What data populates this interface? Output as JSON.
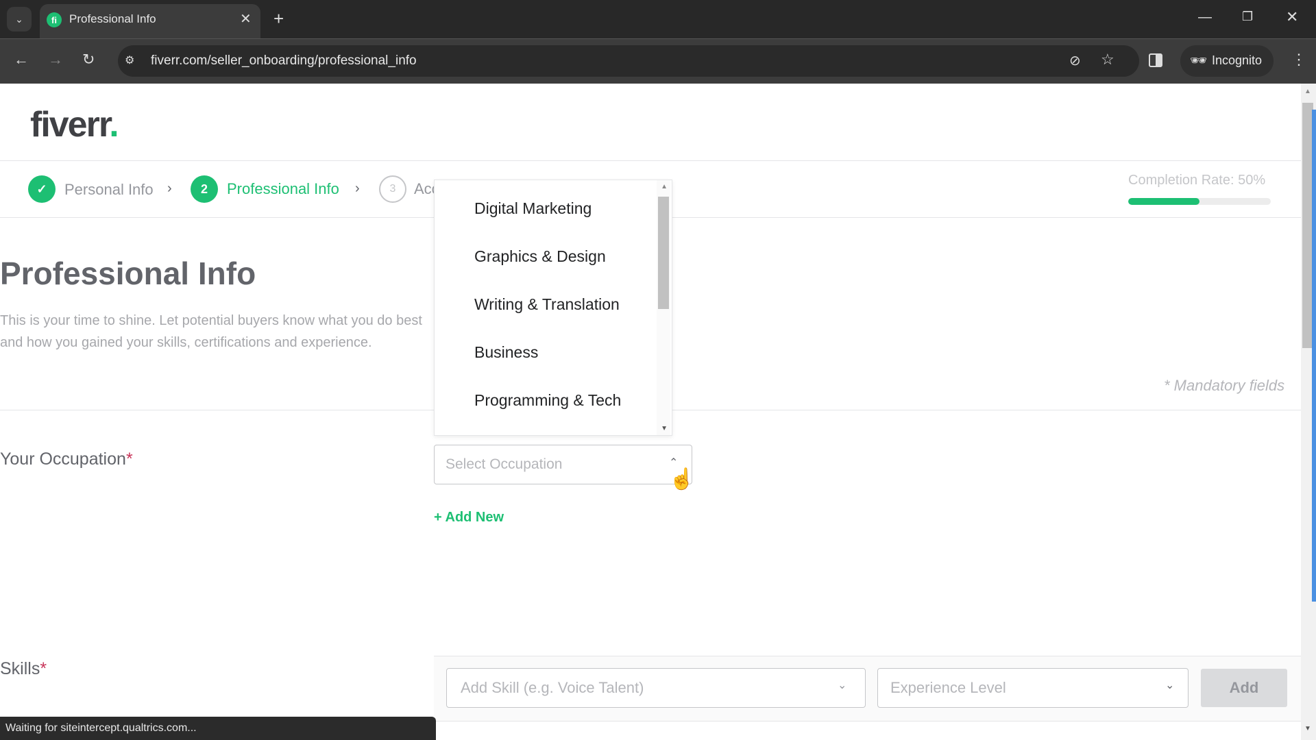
{
  "browser": {
    "tab_title": "Professional Info",
    "tab_favicon": "fi",
    "url": "fiverr.com/seller_onboarding/professional_info",
    "profile_label": "Incognito",
    "status_text": "Waiting for siteintercept.qualtrics.com...",
    "icons": {
      "tab_search": "⌄",
      "tab_close": "✕",
      "new_tab": "+",
      "minimize": "—",
      "maximize": "❐",
      "window_close": "✕",
      "back": "←",
      "forward": "→",
      "reload": "↻",
      "site_info": "⚙",
      "eye_off": "⊘",
      "star": "☆",
      "incognito": "🕶",
      "menu": "⋮"
    }
  },
  "brand": {
    "logo_text": "fiverr",
    "logo_dot": ".",
    "accent_color": "#1dbf73"
  },
  "steps": [
    {
      "number": "✓",
      "label": "Personal Info",
      "state": "complete"
    },
    {
      "number": "2",
      "label": "Professional Info",
      "state": "active"
    },
    {
      "number": "3",
      "label": "Account Security",
      "state": "pending",
      "visible_label": "Ac"
    }
  ],
  "step_separator": "›",
  "completion": {
    "label": "Completion Rate: 50%",
    "percent": 50
  },
  "main": {
    "title": "Professional Info",
    "description": "This is your time to shine. Let potential buyers know what you do best and how you gained your skills, certifications and experience.",
    "mandatory_note": "* Mandatory fields"
  },
  "occupation": {
    "label": "Your Occupation",
    "required_mark": "*",
    "placeholder": "Select Occupation",
    "chevron": "⌃",
    "add_new": "+ Add New",
    "options": [
      "Digital Marketing",
      "Graphics & Design",
      "Writing & Translation",
      "Business",
      "Programming & Tech"
    ]
  },
  "skills": {
    "label": "Skills",
    "required_mark": "*",
    "skill_placeholder": "Add Skill (e.g. Voice Talent)",
    "experience_placeholder": "Experience Level",
    "chevron": "⌄",
    "add_button": "Add"
  }
}
